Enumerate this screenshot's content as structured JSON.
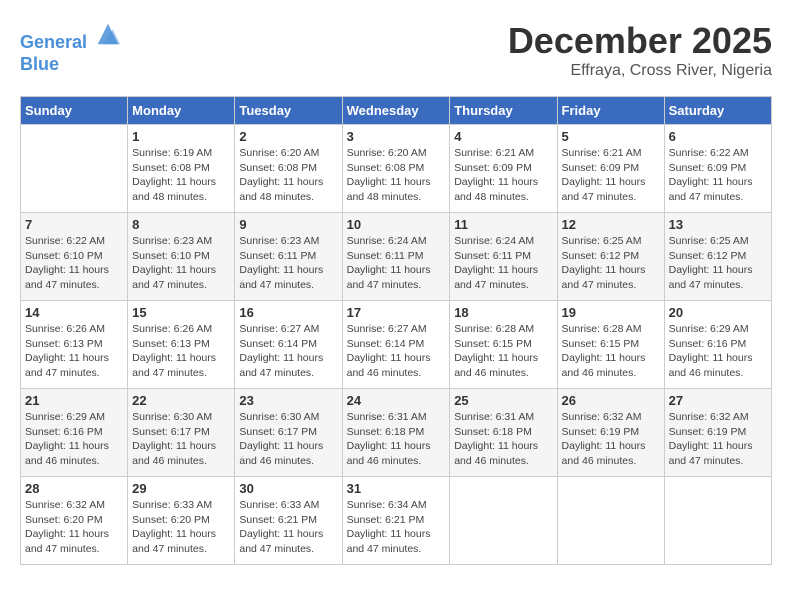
{
  "header": {
    "logo_line1": "General",
    "logo_line2": "Blue",
    "month": "December 2025",
    "location": "Effraya, Cross River, Nigeria"
  },
  "weekdays": [
    "Sunday",
    "Monday",
    "Tuesday",
    "Wednesday",
    "Thursday",
    "Friday",
    "Saturday"
  ],
  "weeks": [
    [
      {
        "day": "",
        "info": ""
      },
      {
        "day": "1",
        "info": "Sunrise: 6:19 AM\nSunset: 6:08 PM\nDaylight: 11 hours\nand 48 minutes."
      },
      {
        "day": "2",
        "info": "Sunrise: 6:20 AM\nSunset: 6:08 PM\nDaylight: 11 hours\nand 48 minutes."
      },
      {
        "day": "3",
        "info": "Sunrise: 6:20 AM\nSunset: 6:08 PM\nDaylight: 11 hours\nand 48 minutes."
      },
      {
        "day": "4",
        "info": "Sunrise: 6:21 AM\nSunset: 6:09 PM\nDaylight: 11 hours\nand 48 minutes."
      },
      {
        "day": "5",
        "info": "Sunrise: 6:21 AM\nSunset: 6:09 PM\nDaylight: 11 hours\nand 47 minutes."
      },
      {
        "day": "6",
        "info": "Sunrise: 6:22 AM\nSunset: 6:09 PM\nDaylight: 11 hours\nand 47 minutes."
      }
    ],
    [
      {
        "day": "7",
        "info": "Sunrise: 6:22 AM\nSunset: 6:10 PM\nDaylight: 11 hours\nand 47 minutes."
      },
      {
        "day": "8",
        "info": "Sunrise: 6:23 AM\nSunset: 6:10 PM\nDaylight: 11 hours\nand 47 minutes."
      },
      {
        "day": "9",
        "info": "Sunrise: 6:23 AM\nSunset: 6:11 PM\nDaylight: 11 hours\nand 47 minutes."
      },
      {
        "day": "10",
        "info": "Sunrise: 6:24 AM\nSunset: 6:11 PM\nDaylight: 11 hours\nand 47 minutes."
      },
      {
        "day": "11",
        "info": "Sunrise: 6:24 AM\nSunset: 6:11 PM\nDaylight: 11 hours\nand 47 minutes."
      },
      {
        "day": "12",
        "info": "Sunrise: 6:25 AM\nSunset: 6:12 PM\nDaylight: 11 hours\nand 47 minutes."
      },
      {
        "day": "13",
        "info": "Sunrise: 6:25 AM\nSunset: 6:12 PM\nDaylight: 11 hours\nand 47 minutes."
      }
    ],
    [
      {
        "day": "14",
        "info": "Sunrise: 6:26 AM\nSunset: 6:13 PM\nDaylight: 11 hours\nand 47 minutes."
      },
      {
        "day": "15",
        "info": "Sunrise: 6:26 AM\nSunset: 6:13 PM\nDaylight: 11 hours\nand 47 minutes."
      },
      {
        "day": "16",
        "info": "Sunrise: 6:27 AM\nSunset: 6:14 PM\nDaylight: 11 hours\nand 47 minutes."
      },
      {
        "day": "17",
        "info": "Sunrise: 6:27 AM\nSunset: 6:14 PM\nDaylight: 11 hours\nand 46 minutes."
      },
      {
        "day": "18",
        "info": "Sunrise: 6:28 AM\nSunset: 6:15 PM\nDaylight: 11 hours\nand 46 minutes."
      },
      {
        "day": "19",
        "info": "Sunrise: 6:28 AM\nSunset: 6:15 PM\nDaylight: 11 hours\nand 46 minutes."
      },
      {
        "day": "20",
        "info": "Sunrise: 6:29 AM\nSunset: 6:16 PM\nDaylight: 11 hours\nand 46 minutes."
      }
    ],
    [
      {
        "day": "21",
        "info": "Sunrise: 6:29 AM\nSunset: 6:16 PM\nDaylight: 11 hours\nand 46 minutes."
      },
      {
        "day": "22",
        "info": "Sunrise: 6:30 AM\nSunset: 6:17 PM\nDaylight: 11 hours\nand 46 minutes."
      },
      {
        "day": "23",
        "info": "Sunrise: 6:30 AM\nSunset: 6:17 PM\nDaylight: 11 hours\nand 46 minutes."
      },
      {
        "day": "24",
        "info": "Sunrise: 6:31 AM\nSunset: 6:18 PM\nDaylight: 11 hours\nand 46 minutes."
      },
      {
        "day": "25",
        "info": "Sunrise: 6:31 AM\nSunset: 6:18 PM\nDaylight: 11 hours\nand 46 minutes."
      },
      {
        "day": "26",
        "info": "Sunrise: 6:32 AM\nSunset: 6:19 PM\nDaylight: 11 hours\nand 46 minutes."
      },
      {
        "day": "27",
        "info": "Sunrise: 6:32 AM\nSunset: 6:19 PM\nDaylight: 11 hours\nand 47 minutes."
      }
    ],
    [
      {
        "day": "28",
        "info": "Sunrise: 6:32 AM\nSunset: 6:20 PM\nDaylight: 11 hours\nand 47 minutes."
      },
      {
        "day": "29",
        "info": "Sunrise: 6:33 AM\nSunset: 6:20 PM\nDaylight: 11 hours\nand 47 minutes."
      },
      {
        "day": "30",
        "info": "Sunrise: 6:33 AM\nSunset: 6:21 PM\nDaylight: 11 hours\nand 47 minutes."
      },
      {
        "day": "31",
        "info": "Sunrise: 6:34 AM\nSunset: 6:21 PM\nDaylight: 11 hours\nand 47 minutes."
      },
      {
        "day": "",
        "info": ""
      },
      {
        "day": "",
        "info": ""
      },
      {
        "day": "",
        "info": ""
      }
    ]
  ]
}
